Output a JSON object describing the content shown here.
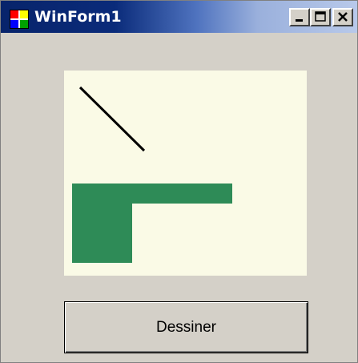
{
  "window": {
    "title": "WinForm1",
    "title_bar_colors": [
      "#08246b",
      "#b8c9ea"
    ],
    "background": "#d4d0c8",
    "controls": {
      "minimize_icon": "minimize-icon",
      "maximize_icon": "maximize-icon",
      "close_icon": "close-icon"
    }
  },
  "canvas": {
    "background": "#fafae6",
    "stroke_color": "#000000",
    "fill_color": "#2e8b57"
  },
  "button": {
    "label": "Dessiner"
  }
}
